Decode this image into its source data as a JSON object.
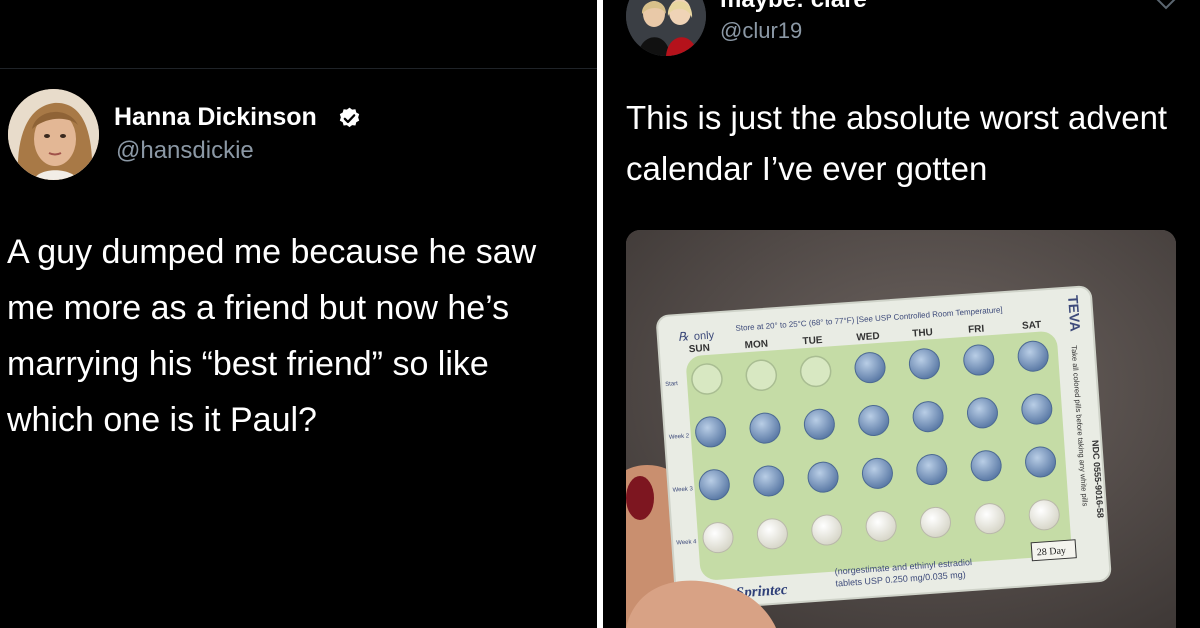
{
  "left_tweet": {
    "author": {
      "name": "Hanna Dickinson",
      "handle": "@hansdickie",
      "verified": true
    },
    "text_lines": [
      "A guy dumped me because he saw",
      "me more as a friend but now he’s",
      "marrying his “best friend” so like",
      "which one is it Paul?"
    ]
  },
  "right_tweet": {
    "author": {
      "name": "maybe: clare",
      "handle": "@clur19"
    },
    "text_lines": [
      "This is just the absolute worst advent",
      "calendar I’ve ever gotten"
    ],
    "photo": {
      "top_note": "Store at 20° to 25°C (68° to 77°F) [See USP Controlled Room Temperature]",
      "rx": "only",
      "days": [
        "SUN",
        "MON",
        "TUE",
        "WED",
        "THU",
        "FRI",
        "SAT"
      ],
      "week_labels": [
        "Start",
        "Week 2",
        "Week 3",
        "Week 4"
      ],
      "side_brand": "TEVA",
      "side_note": "Take all colored pills before taking any white pills",
      "ndc": "NDC 0555-9016-58",
      "day_count": "28 Day",
      "ingredients_1": "(norgestimate and ethinyl estradiol",
      "ingredients_2": "tablets USP 0.250 mg/0.035 mg)",
      "brand": "Sprintec"
    }
  }
}
